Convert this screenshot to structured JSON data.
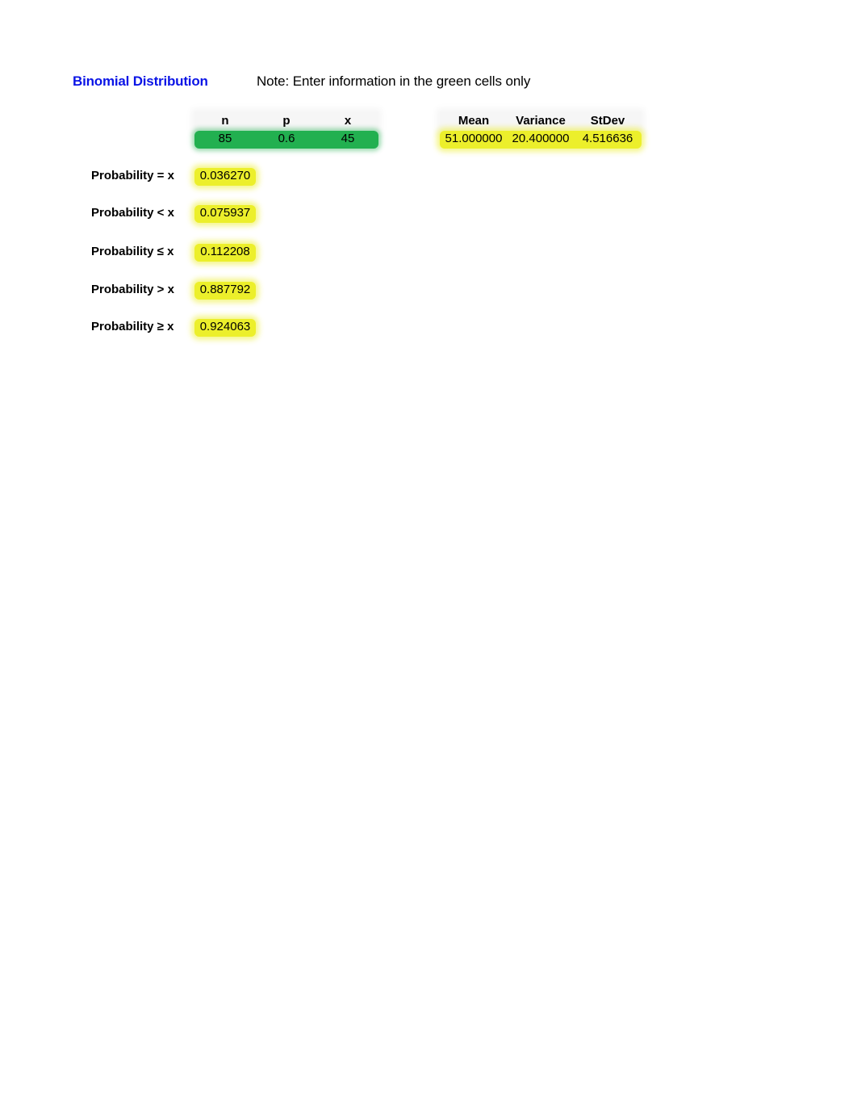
{
  "header": {
    "title": "Binomial Distribution",
    "note": "Note: Enter information in the green cells only"
  },
  "inputs": {
    "headers": [
      "n",
      "p",
      "x"
    ],
    "values": [
      "85",
      "0.6",
      "45"
    ],
    "fill_color": "#22b050"
  },
  "stats": {
    "headers": [
      "Mean",
      "Variance",
      "StDev"
    ],
    "values": [
      "51.000000",
      "20.400000",
      "4.516636"
    ],
    "fill_color": "#ecef2b"
  },
  "probabilities": [
    {
      "label": "Probability = x",
      "value": "0.036270"
    },
    {
      "label": "Probability < x",
      "value": "0.075937"
    },
    {
      "label": "Probability ≤ x",
      "value": "0.112208"
    },
    {
      "label": "Probability > x",
      "value": "0.887792"
    },
    {
      "label": "Probability ≥ x",
      "value": "0.924063"
    }
  ],
  "colors": {
    "title": "#0a14e6",
    "input_fill": "#22b050",
    "output_fill": "#ecef2b"
  }
}
